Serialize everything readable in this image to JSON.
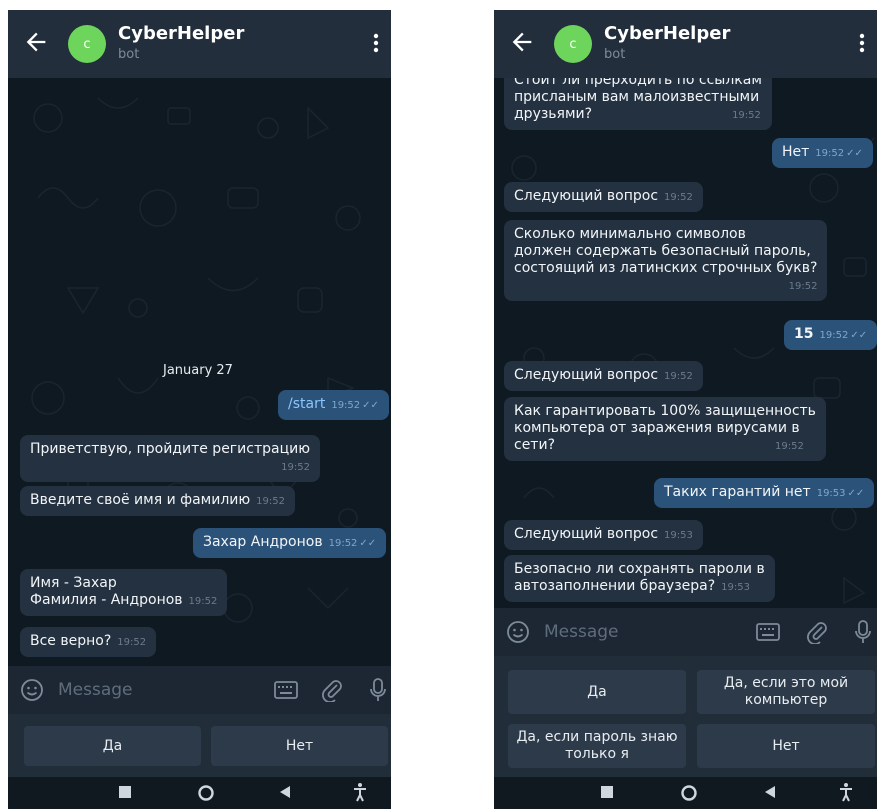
{
  "chat_header": {
    "avatar_letter": "c",
    "title": "CyberHelper",
    "subtitle": "bot"
  },
  "left_screen": {
    "date_label": "January 27",
    "messages": [
      {
        "dir": "out",
        "text": "/start",
        "time": "19:52"
      },
      {
        "dir": "in",
        "text": "Приветствую, пройдите регистрацию",
        "time": "19:52"
      },
      {
        "dir": "in",
        "text": "Введите своё имя и фамилию",
        "time": "19:52"
      },
      {
        "dir": "out",
        "text": "Захар Андронов",
        "time": "19:52"
      },
      {
        "dir": "in",
        "line1": "Имя - Захар",
        "line2": "Фамилия - Андронов",
        "time": "19:52"
      },
      {
        "dir": "in",
        "text": "Все верно?",
        "time": "19:52"
      }
    ],
    "input_placeholder": "Message",
    "reply_buttons": [
      "Да",
      "Нет"
    ]
  },
  "right_screen": {
    "messages": [
      {
        "dir": "in",
        "line1": "Стоит ли прерходить по ссылкам",
        "line2": "присланым вам малоизвестными",
        "line3": "друзьями?",
        "time": "19:52"
      },
      {
        "dir": "out",
        "text": "Нет",
        "time": "19:52"
      },
      {
        "dir": "in",
        "text": "Следующий вопрос",
        "time": "19:52"
      },
      {
        "dir": "in",
        "line1": "Сколько минимально символов",
        "line2": "должен содержать безопасный пароль,",
        "line3": "состоящий из латинских строчных букв?",
        "time": "19:52"
      },
      {
        "dir": "out",
        "text": "15",
        "time": "19:52"
      },
      {
        "dir": "in",
        "text": "Следующий вопрос",
        "time": "19:52"
      },
      {
        "dir": "in",
        "line1": "Как гарантировать 100% защищенность",
        "line2": "компьютера от заражения вирусами в",
        "line3": "сети?",
        "time": "19:52"
      },
      {
        "dir": "out",
        "text": "Таких гарантий нет",
        "time": "19:53"
      },
      {
        "dir": "in",
        "text": "Следующий вопрос",
        "time": "19:53"
      },
      {
        "dir": "in",
        "line1": "Безопасно ли сохранять пароли в",
        "line2": "автозаполнении браузера?",
        "time": "19:53"
      }
    ],
    "input_placeholder": "Message",
    "reply_buttons": [
      {
        "line1": "Да"
      },
      {
        "line1": "Да, если это мой",
        "line2": "компьютер"
      },
      {
        "line1": "Да, если пароль знаю",
        "line2": "только я"
      },
      {
        "line1": "Нет"
      }
    ]
  },
  "colors": {
    "header_bg": "#232e3c",
    "chat_bg": "#0f1921",
    "incoming_bubble": "#243140",
    "outgoing_bubble": "#2b5279",
    "avatar": "#6dd55c",
    "button_bg": "#2d3a49"
  },
  "icons": [
    "back-arrow-icon",
    "more-vert-icon",
    "smile-icon",
    "keyboard-icon",
    "paperclip-icon",
    "mic-icon",
    "nav-square-icon",
    "nav-circle-icon",
    "nav-back-triangle-icon",
    "accessibility-icon",
    "double-check-icon"
  ]
}
